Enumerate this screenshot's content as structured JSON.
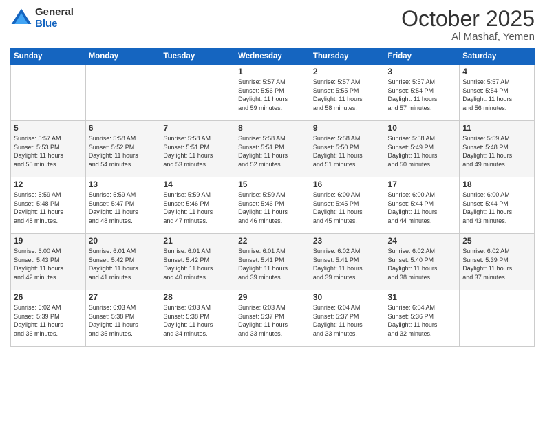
{
  "logo": {
    "general": "General",
    "blue": "Blue"
  },
  "header": {
    "month": "October 2025",
    "location": "Al Mashaf, Yemen"
  },
  "weekdays": [
    "Sunday",
    "Monday",
    "Tuesday",
    "Wednesday",
    "Thursday",
    "Friday",
    "Saturday"
  ],
  "weeks": [
    [
      {
        "day": "",
        "info": ""
      },
      {
        "day": "",
        "info": ""
      },
      {
        "day": "",
        "info": ""
      },
      {
        "day": "1",
        "info": "Sunrise: 5:57 AM\nSunset: 5:56 PM\nDaylight: 11 hours\nand 59 minutes."
      },
      {
        "day": "2",
        "info": "Sunrise: 5:57 AM\nSunset: 5:55 PM\nDaylight: 11 hours\nand 58 minutes."
      },
      {
        "day": "3",
        "info": "Sunrise: 5:57 AM\nSunset: 5:54 PM\nDaylight: 11 hours\nand 57 minutes."
      },
      {
        "day": "4",
        "info": "Sunrise: 5:57 AM\nSunset: 5:54 PM\nDaylight: 11 hours\nand 56 minutes."
      }
    ],
    [
      {
        "day": "5",
        "info": "Sunrise: 5:57 AM\nSunset: 5:53 PM\nDaylight: 11 hours\nand 55 minutes."
      },
      {
        "day": "6",
        "info": "Sunrise: 5:58 AM\nSunset: 5:52 PM\nDaylight: 11 hours\nand 54 minutes."
      },
      {
        "day": "7",
        "info": "Sunrise: 5:58 AM\nSunset: 5:51 PM\nDaylight: 11 hours\nand 53 minutes."
      },
      {
        "day": "8",
        "info": "Sunrise: 5:58 AM\nSunset: 5:51 PM\nDaylight: 11 hours\nand 52 minutes."
      },
      {
        "day": "9",
        "info": "Sunrise: 5:58 AM\nSunset: 5:50 PM\nDaylight: 11 hours\nand 51 minutes."
      },
      {
        "day": "10",
        "info": "Sunrise: 5:58 AM\nSunset: 5:49 PM\nDaylight: 11 hours\nand 50 minutes."
      },
      {
        "day": "11",
        "info": "Sunrise: 5:59 AM\nSunset: 5:48 PM\nDaylight: 11 hours\nand 49 minutes."
      }
    ],
    [
      {
        "day": "12",
        "info": "Sunrise: 5:59 AM\nSunset: 5:48 PM\nDaylight: 11 hours\nand 48 minutes."
      },
      {
        "day": "13",
        "info": "Sunrise: 5:59 AM\nSunset: 5:47 PM\nDaylight: 11 hours\nand 48 minutes."
      },
      {
        "day": "14",
        "info": "Sunrise: 5:59 AM\nSunset: 5:46 PM\nDaylight: 11 hours\nand 47 minutes."
      },
      {
        "day": "15",
        "info": "Sunrise: 5:59 AM\nSunset: 5:46 PM\nDaylight: 11 hours\nand 46 minutes."
      },
      {
        "day": "16",
        "info": "Sunrise: 6:00 AM\nSunset: 5:45 PM\nDaylight: 11 hours\nand 45 minutes."
      },
      {
        "day": "17",
        "info": "Sunrise: 6:00 AM\nSunset: 5:44 PM\nDaylight: 11 hours\nand 44 minutes."
      },
      {
        "day": "18",
        "info": "Sunrise: 6:00 AM\nSunset: 5:44 PM\nDaylight: 11 hours\nand 43 minutes."
      }
    ],
    [
      {
        "day": "19",
        "info": "Sunrise: 6:00 AM\nSunset: 5:43 PM\nDaylight: 11 hours\nand 42 minutes."
      },
      {
        "day": "20",
        "info": "Sunrise: 6:01 AM\nSunset: 5:42 PM\nDaylight: 11 hours\nand 41 minutes."
      },
      {
        "day": "21",
        "info": "Sunrise: 6:01 AM\nSunset: 5:42 PM\nDaylight: 11 hours\nand 40 minutes."
      },
      {
        "day": "22",
        "info": "Sunrise: 6:01 AM\nSunset: 5:41 PM\nDaylight: 11 hours\nand 39 minutes."
      },
      {
        "day": "23",
        "info": "Sunrise: 6:02 AM\nSunset: 5:41 PM\nDaylight: 11 hours\nand 39 minutes."
      },
      {
        "day": "24",
        "info": "Sunrise: 6:02 AM\nSunset: 5:40 PM\nDaylight: 11 hours\nand 38 minutes."
      },
      {
        "day": "25",
        "info": "Sunrise: 6:02 AM\nSunset: 5:39 PM\nDaylight: 11 hours\nand 37 minutes."
      }
    ],
    [
      {
        "day": "26",
        "info": "Sunrise: 6:02 AM\nSunset: 5:39 PM\nDaylight: 11 hours\nand 36 minutes."
      },
      {
        "day": "27",
        "info": "Sunrise: 6:03 AM\nSunset: 5:38 PM\nDaylight: 11 hours\nand 35 minutes."
      },
      {
        "day": "28",
        "info": "Sunrise: 6:03 AM\nSunset: 5:38 PM\nDaylight: 11 hours\nand 34 minutes."
      },
      {
        "day": "29",
        "info": "Sunrise: 6:03 AM\nSunset: 5:37 PM\nDaylight: 11 hours\nand 33 minutes."
      },
      {
        "day": "30",
        "info": "Sunrise: 6:04 AM\nSunset: 5:37 PM\nDaylight: 11 hours\nand 33 minutes."
      },
      {
        "day": "31",
        "info": "Sunrise: 6:04 AM\nSunset: 5:36 PM\nDaylight: 11 hours\nand 32 minutes."
      },
      {
        "day": "",
        "info": ""
      }
    ]
  ]
}
